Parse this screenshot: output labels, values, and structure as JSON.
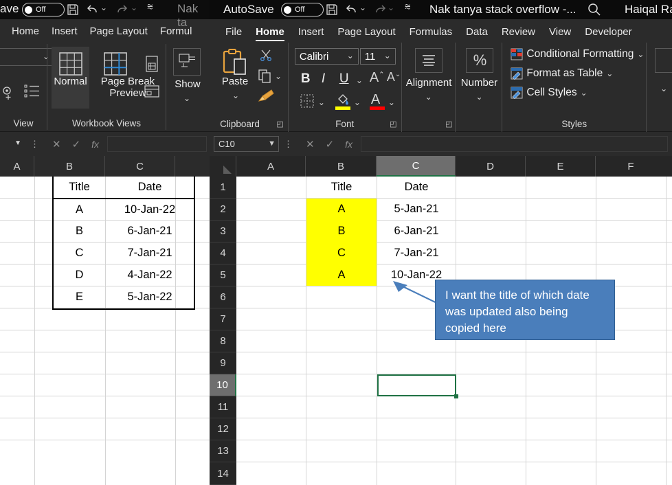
{
  "background_window": {
    "titlebar": {
      "autosave_label": "ave",
      "autosave_state": "Off",
      "save_icon": "save-icon",
      "undo_icon": "undo-icon",
      "redo_icon": "redo-icon",
      "customize_icon": "customize-quick-access-icon",
      "doc_title": "Nak ta"
    },
    "tabs": [
      "Home",
      "Insert",
      "Page Layout",
      "Formul"
    ],
    "ribbon": {
      "view_group_label": "View",
      "workbook_views_label": "Workbook Views",
      "normal_label": "Normal",
      "page_break_preview_label": "Page Break Preview",
      "show_label": "Show",
      "page_layout_icon": "page-layout-icon",
      "custom_views_icon": "custom-views-icon"
    },
    "formula_bar": {
      "cancel_icon": "cancel-icon",
      "enter_icon": "confirm-icon",
      "fx_label": "fx",
      "value": ""
    },
    "columns": [
      "A",
      "B",
      "C"
    ],
    "table": {
      "headers": [
        "Title",
        "Date"
      ],
      "rows": [
        [
          "A",
          "10-Jan-22"
        ],
        [
          "B",
          "6-Jan-21"
        ],
        [
          "C",
          "7-Jan-21"
        ],
        [
          "D",
          "4-Jan-22"
        ],
        [
          "E",
          "5-Jan-22"
        ]
      ]
    }
  },
  "foreground_window": {
    "titlebar": {
      "autosave_label": "AutoSave",
      "autosave_state": "Off",
      "save_icon": "save-icon",
      "undo_icon": "undo-icon",
      "redo_icon": "redo-icon",
      "customize_icon": "customize-quick-access-icon",
      "doc_title": "Nak tanya stack overflow  -...",
      "search_icon": "search-icon",
      "account_name": "Haiqal Rah"
    },
    "tabs": [
      {
        "label": "File",
        "active": false
      },
      {
        "label": "Home",
        "active": true
      },
      {
        "label": "Insert",
        "active": false
      },
      {
        "label": "Page Layout",
        "active": false
      },
      {
        "label": "Formulas",
        "active": false
      },
      {
        "label": "Data",
        "active": false
      },
      {
        "label": "Review",
        "active": false
      },
      {
        "label": "View",
        "active": false
      },
      {
        "label": "Developer",
        "active": false
      }
    ],
    "ribbon": {
      "clipboard": {
        "label": "Clipboard",
        "paste_label": "Paste",
        "paste_icon": "paste-icon",
        "cut_icon": "scissors-icon",
        "copy_icon": "copy-icon",
        "format_painter_icon": "format-painter-icon",
        "dialog_launcher_icon": "dialog-launcher-icon"
      },
      "font": {
        "label": "Font",
        "font_name": "Calibri",
        "font_size": "11",
        "bold_label": "B",
        "italic_label": "I",
        "underline_label": "U",
        "grow_font_label": "A",
        "shrink_font_label": "A",
        "borders_icon": "borders-icon",
        "fill_color_icon": "fill-color-icon",
        "font_color_icon": "font-color-icon",
        "fill_color": "#ffff00",
        "font_color": "#ff0000",
        "dialog_launcher_icon": "dialog-launcher-icon"
      },
      "alignment": {
        "label": "Alignment",
        "icon": "alignment-icon"
      },
      "number": {
        "label": "Number",
        "icon": "percent-icon",
        "glyph": "%"
      },
      "styles": {
        "label": "Styles",
        "items": [
          {
            "label": "Conditional Formatting",
            "icon": "conditional-formatting-icon"
          },
          {
            "label": "Format as Table",
            "icon": "format-as-table-icon"
          },
          {
            "label": "Cell Styles",
            "icon": "cell-styles-icon"
          }
        ]
      }
    },
    "formula_bar": {
      "name_box_value": "C10",
      "cancel_icon": "cancel-icon",
      "enter_icon": "confirm-icon",
      "fx_label": "fx",
      "value": ""
    },
    "columns": [
      "A",
      "B",
      "C",
      "D",
      "E",
      "F"
    ],
    "selected_column": "C",
    "rows": [
      "1",
      "2",
      "3",
      "4",
      "5",
      "6",
      "7",
      "8",
      "9",
      "10",
      "11",
      "12",
      "13",
      "14"
    ],
    "selected_row": "10",
    "selected_cell": "C10",
    "sheet_cells": [
      {
        "ref": "B1",
        "value": "Title"
      },
      {
        "ref": "C1",
        "value": "Date"
      },
      {
        "ref": "B2",
        "value": "A",
        "highlight": "#ffff00"
      },
      {
        "ref": "C2",
        "value": "5-Jan-21"
      },
      {
        "ref": "B3",
        "value": "B",
        "highlight": "#ffff00"
      },
      {
        "ref": "C3",
        "value": "6-Jan-21"
      },
      {
        "ref": "B4",
        "value": "C",
        "highlight": "#ffff00"
      },
      {
        "ref": "C4",
        "value": "7-Jan-21"
      },
      {
        "ref": "B5",
        "value": "A",
        "highlight": "#ffff00"
      },
      {
        "ref": "C5",
        "value": "10-Jan-22"
      }
    ],
    "callout": {
      "text": "I want the title of which date was updated also being copied here",
      "fill_color": "#4a7ebb",
      "border_color": "#2f5e92",
      "arrow_color": "#4a7ebb"
    }
  }
}
